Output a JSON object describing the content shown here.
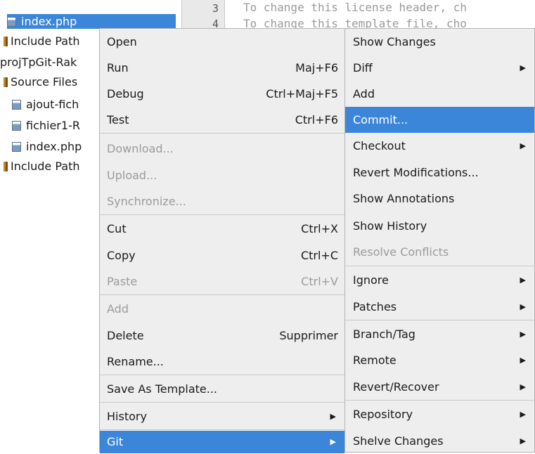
{
  "tree": {
    "items": [
      {
        "label": "index.php",
        "icon": "php-file-icon",
        "selected": true
      },
      {
        "label": "Include Path",
        "icon": "library-icon"
      },
      {
        "label": "projTpGit-Rak",
        "icon": ""
      },
      {
        "label": "Source Files",
        "icon": "library-icon"
      },
      {
        "label": "ajout-fich",
        "icon": "php-file-icon"
      },
      {
        "label": "fichier1-R",
        "icon": "php-file-icon"
      },
      {
        "label": "index.php",
        "icon": "php-file-icon"
      },
      {
        "label": "Include Path",
        "icon": "library-icon"
      }
    ]
  },
  "editor": {
    "lines": [
      {
        "number": "3",
        "text": "To change this license header, ch"
      },
      {
        "number": "4",
        "text": "To change this template file, cho"
      }
    ]
  },
  "context_menu": {
    "items": [
      {
        "label": "Open",
        "shortcut": "",
        "disabled": false
      },
      {
        "label": "Run",
        "shortcut": "Maj+F6",
        "disabled": false
      },
      {
        "label": "Debug",
        "shortcut": "Ctrl+Maj+F5",
        "disabled": false
      },
      {
        "label": "Test",
        "shortcut": "Ctrl+F6",
        "disabled": false
      },
      {
        "label": "Download...",
        "shortcut": "",
        "disabled": true
      },
      {
        "label": "Upload...",
        "shortcut": "",
        "disabled": true
      },
      {
        "label": "Synchronize...",
        "shortcut": "",
        "disabled": true
      },
      {
        "label": "Cut",
        "shortcut": "Ctrl+X",
        "disabled": false
      },
      {
        "label": "Copy",
        "shortcut": "Ctrl+C",
        "disabled": false
      },
      {
        "label": "Paste",
        "shortcut": "Ctrl+V",
        "disabled": true
      },
      {
        "label": "Add",
        "shortcut": "",
        "disabled": true
      },
      {
        "label": "Delete",
        "shortcut": "Supprimer",
        "disabled": false
      },
      {
        "label": "Rename...",
        "shortcut": "",
        "disabled": false
      },
      {
        "label": "Save As Template...",
        "shortcut": "",
        "disabled": false
      },
      {
        "label": "History",
        "shortcut": "",
        "disabled": false,
        "submenu": true
      },
      {
        "label": "Git",
        "shortcut": "",
        "disabled": false,
        "submenu": true,
        "highlighted": true
      }
    ]
  },
  "git_menu": {
    "items": [
      {
        "label": "Show Changes"
      },
      {
        "label": "Diff",
        "submenu": true
      },
      {
        "label": "Add"
      },
      {
        "label": "Commit...",
        "highlighted": true
      },
      {
        "label": "Checkout",
        "submenu": true
      },
      {
        "label": "Revert Modifications..."
      },
      {
        "label": "Show Annotations"
      },
      {
        "label": "Show History"
      },
      {
        "label": "Resolve Conflicts",
        "disabled": true
      },
      {
        "label": "Ignore",
        "submenu": true
      },
      {
        "label": "Patches",
        "submenu": true
      },
      {
        "label": "Branch/Tag",
        "submenu": true
      },
      {
        "label": "Remote",
        "submenu": true
      },
      {
        "label": "Revert/Recover",
        "submenu": true
      },
      {
        "label": "Repository",
        "submenu": true
      },
      {
        "label": "Shelve Changes",
        "submenu": true
      }
    ]
  },
  "colors": {
    "highlight": "#3b86d9",
    "menu_bg": "#eeeeee",
    "disabled_text": "#9b9b9b"
  },
  "submenu_arrow": "▶"
}
